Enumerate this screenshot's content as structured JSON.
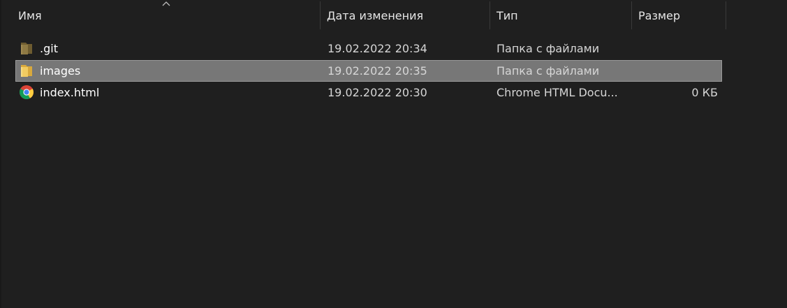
{
  "columns": {
    "name": "Имя",
    "date": "Дата изменения",
    "type": "Тип",
    "size": "Размер"
  },
  "sort": {
    "column": "name",
    "direction": "ascending",
    "icon": "sort-up-icon"
  },
  "files": [
    {
      "name": ".git",
      "date": "19.02.2022 20:34",
      "type": "Папка с файлами",
      "size": "",
      "icon": "folder-icon",
      "hidden": true,
      "selected": false
    },
    {
      "name": "images",
      "date": "19.02.2022 20:35",
      "type": "Папка с файлами",
      "size": "",
      "icon": "folder-icon",
      "hidden": false,
      "selected": true
    },
    {
      "name": "index.html",
      "date": "19.02.2022 20:30",
      "type": "Chrome HTML Docu...",
      "size": "0 КБ",
      "icon": "chrome-icon",
      "hidden": false,
      "selected": false
    }
  ],
  "colors": {
    "background": "#1f1f1f",
    "selection": "#777777",
    "folder": "#e8c15a",
    "folder_hidden": "#8f7a44"
  }
}
